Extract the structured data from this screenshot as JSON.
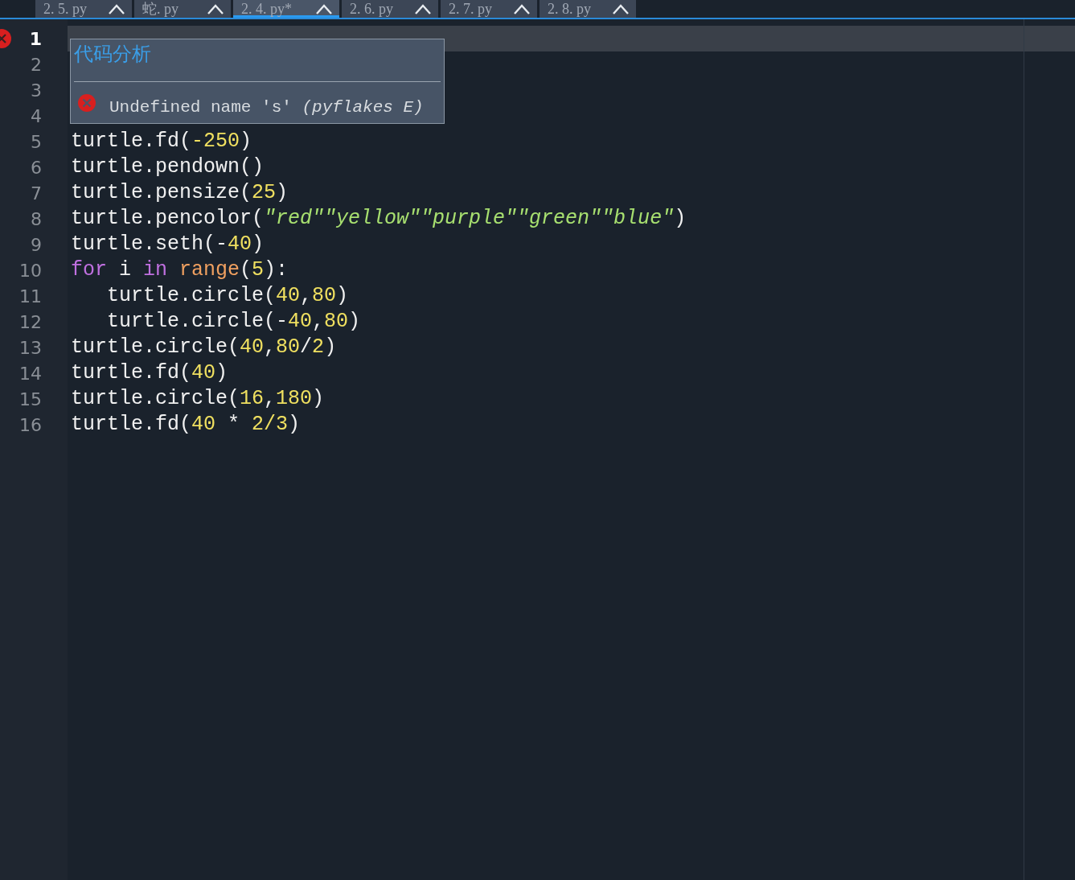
{
  "tabs": [
    {
      "label": "2. 5. py",
      "selected": false
    },
    {
      "label": "蛇. py",
      "selected": false
    },
    {
      "label": "2. 4. py*",
      "selected": true
    },
    {
      "label": "2. 6. py",
      "selected": false
    },
    {
      "label": "2. 7. py",
      "selected": false
    },
    {
      "label": "2. 8. py",
      "selected": false
    }
  ],
  "editor": {
    "lines": [
      {
        "number": "1",
        "current": true,
        "error": true
      },
      {
        "number": "2",
        "current": false,
        "error": false
      },
      {
        "number": "3",
        "current": false,
        "error": false
      },
      {
        "number": "4",
        "current": false,
        "error": false
      },
      {
        "number": "5",
        "current": false,
        "error": false,
        "tokens": [
          {
            "kind": "plain",
            "text": "turtle.fd("
          },
          {
            "kind": "number",
            "text": "-250"
          },
          {
            "kind": "plain",
            "text": ")"
          }
        ]
      },
      {
        "number": "6",
        "current": false,
        "error": false,
        "tokens": [
          {
            "kind": "plain",
            "text": "turtle.pendown()"
          }
        ]
      },
      {
        "number": "7",
        "current": false,
        "error": false,
        "tokens": [
          {
            "kind": "plain",
            "text": "turtle.pensize("
          },
          {
            "kind": "number",
            "text": "25"
          },
          {
            "kind": "plain",
            "text": ")"
          }
        ]
      },
      {
        "number": "8",
        "current": false,
        "error": false,
        "tokens": [
          {
            "kind": "plain",
            "text": "turtle.pencolor("
          },
          {
            "kind": "string",
            "text": "\"red\"\"yellow\"\"purple\"\"green\"\"blue\""
          },
          {
            "kind": "plain",
            "text": ")"
          }
        ]
      },
      {
        "number": "9",
        "current": false,
        "error": false,
        "tokens": [
          {
            "kind": "plain",
            "text": "turtle.seth(-"
          },
          {
            "kind": "number",
            "text": "40"
          },
          {
            "kind": "plain",
            "text": ")"
          }
        ]
      },
      {
        "number": "10",
        "current": false,
        "error": false,
        "tokens": [
          {
            "kind": "keyword",
            "text": "for"
          },
          {
            "kind": "plain",
            "text": " i "
          },
          {
            "kind": "keyword",
            "text": "in "
          },
          {
            "kind": "builtin",
            "text": "range"
          },
          {
            "kind": "plain",
            "text": "("
          },
          {
            "kind": "number",
            "text": "5"
          },
          {
            "kind": "plain",
            "text": "):"
          }
        ]
      },
      {
        "number": "11",
        "current": false,
        "error": false,
        "tokens": [
          {
            "kind": "plain",
            "text": "   turtle.circle("
          },
          {
            "kind": "number",
            "text": "40"
          },
          {
            "kind": "plain",
            "text": ","
          },
          {
            "kind": "number",
            "text": "80"
          },
          {
            "kind": "plain",
            "text": ")"
          }
        ]
      },
      {
        "number": "12",
        "current": false,
        "error": false,
        "tokens": [
          {
            "kind": "plain",
            "text": "   turtle.circle(-"
          },
          {
            "kind": "number",
            "text": "40"
          },
          {
            "kind": "plain",
            "text": ","
          },
          {
            "kind": "number",
            "text": "80"
          },
          {
            "kind": "plain",
            "text": ")"
          }
        ]
      },
      {
        "number": "13",
        "current": false,
        "error": false,
        "tokens": [
          {
            "kind": "plain",
            "text": "turtle.circle("
          },
          {
            "kind": "number",
            "text": "40"
          },
          {
            "kind": "plain",
            "text": ","
          },
          {
            "kind": "number",
            "text": "80"
          },
          {
            "kind": "plain",
            "text": "/"
          },
          {
            "kind": "number",
            "text": "2"
          },
          {
            "kind": "plain",
            "text": ")"
          }
        ]
      },
      {
        "number": "14",
        "current": false,
        "error": false,
        "tokens": [
          {
            "kind": "plain",
            "text": "turtle.fd("
          },
          {
            "kind": "number",
            "text": "40"
          },
          {
            "kind": "plain",
            "text": ")"
          }
        ]
      },
      {
        "number": "15",
        "current": false,
        "error": false,
        "tokens": [
          {
            "kind": "plain",
            "text": "turtle.circle("
          },
          {
            "kind": "number",
            "text": "16"
          },
          {
            "kind": "plain",
            "text": ","
          },
          {
            "kind": "number",
            "text": "180"
          },
          {
            "kind": "plain",
            "text": ")"
          }
        ]
      },
      {
        "number": "16",
        "current": false,
        "error": false,
        "tokens": [
          {
            "kind": "plain",
            "text": "turtle.fd("
          },
          {
            "kind": "number",
            "text": "40"
          },
          {
            "kind": "plain",
            "text": " * "
          },
          {
            "kind": "number",
            "text": "2/3"
          },
          {
            "kind": "plain",
            "text": ")"
          }
        ]
      }
    ]
  },
  "tooltip": {
    "title": "代码分析",
    "message": "Undefined name 's'",
    "source": "(pyflakes E)"
  }
}
